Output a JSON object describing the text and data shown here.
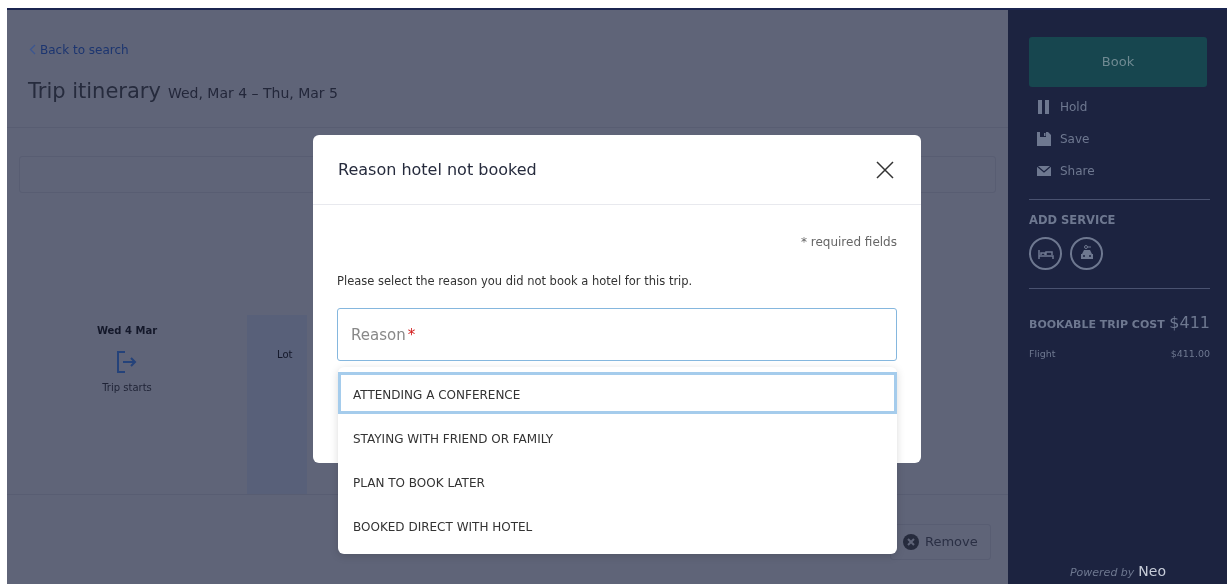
{
  "header": {
    "back_link": "Back to search",
    "title": "Trip itinerary",
    "dates": "Wed, Mar 4 – Thu, Mar 5"
  },
  "timeline": [
    {
      "date": "Wed 4 Mar",
      "label": "Trip starts"
    }
  ],
  "timeline_fragment": "Lot",
  "remove_button": "Remove",
  "sidebar": {
    "book_button": "Book",
    "actions": [
      {
        "label": "Hold",
        "kind": "hold"
      },
      {
        "label": "Save",
        "kind": "save"
      },
      {
        "label": "Share",
        "kind": "share"
      }
    ],
    "add_service": {
      "title": "ADD SERVICE",
      "services": [
        {
          "kind": "hotel"
        },
        {
          "kind": "car"
        }
      ]
    },
    "cost": {
      "title": "BOOKABLE TRIP COST",
      "total": "$411",
      "items": [
        {
          "label": "Flight",
          "amount": "$411.00"
        }
      ]
    },
    "powered_by": "Powered by",
    "brand": "Neo"
  },
  "modal": {
    "title": "Reason hotel not booked",
    "required_note": "* required fields",
    "prompt": "Please select the reason you did not book a hotel for this trip.",
    "field": {
      "placeholder": "Reason",
      "required_mark": "*"
    },
    "options": [
      {
        "label": "ATTENDING A CONFERENCE",
        "selected": true
      },
      {
        "label": "STAYING WITH FRIEND OR FAMILY",
        "selected": false
      },
      {
        "label": "PLAN TO BOOK LATER",
        "selected": false
      },
      {
        "label": "BOOKED DIRECT WITH HOTEL",
        "selected": false
      }
    ]
  }
}
